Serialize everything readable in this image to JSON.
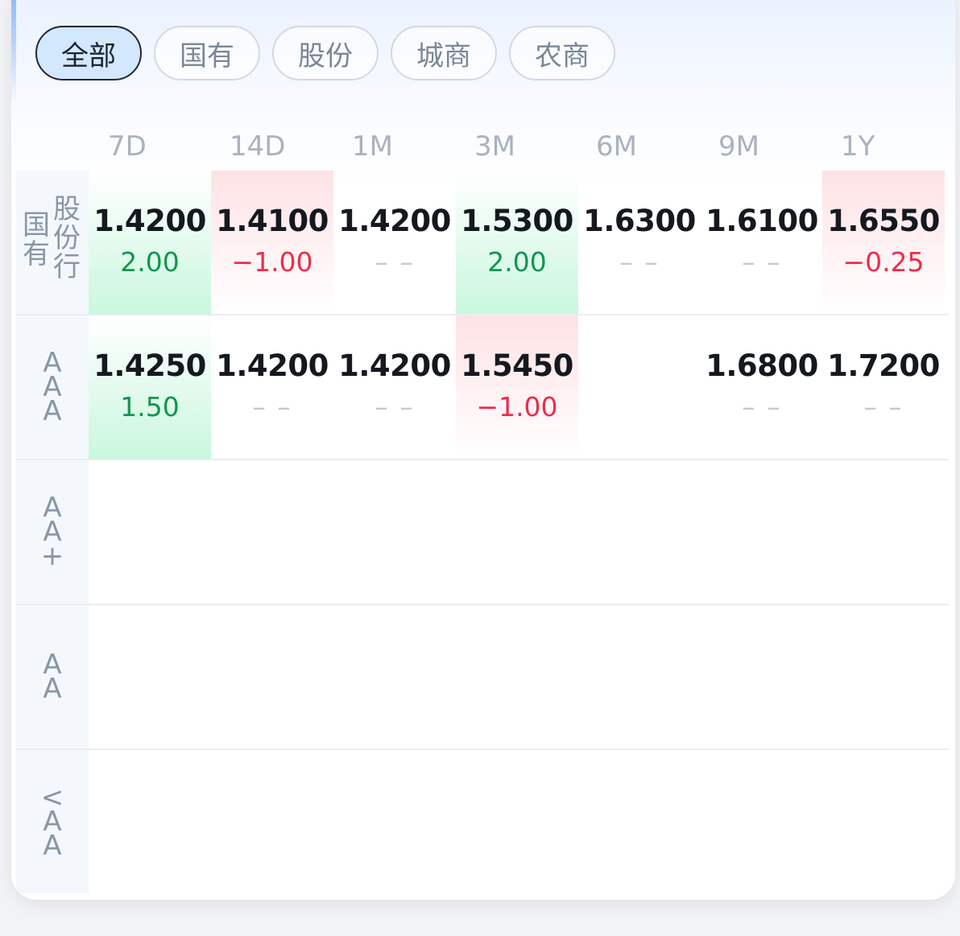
{
  "filters": {
    "items": [
      {
        "label": "全部",
        "active": true
      },
      {
        "label": "国有",
        "active": false
      },
      {
        "label": "股份",
        "active": false
      },
      {
        "label": "城商",
        "active": false
      },
      {
        "label": "农商",
        "active": false
      }
    ]
  },
  "tenors": [
    "7D",
    "14D",
    "1M",
    "3M",
    "6M",
    "9M",
    "1Y"
  ],
  "rows": [
    {
      "label_left": "国有",
      "label_right": "股份行",
      "cells": [
        {
          "rate": "1.4200",
          "change": "2.00",
          "trend": "up"
        },
        {
          "rate": "1.4100",
          "change": "−1.00",
          "trend": "down"
        },
        {
          "rate": "1.4200",
          "change": "– –",
          "trend": "none"
        },
        {
          "rate": "1.5300",
          "change": "2.00",
          "trend": "up"
        },
        {
          "rate": "1.6300",
          "change": "– –",
          "trend": "none"
        },
        {
          "rate": "1.6100",
          "change": "– –",
          "trend": "none"
        },
        {
          "rate": "1.6550",
          "change": "−0.25",
          "trend": "down"
        }
      ]
    },
    {
      "label": "AAA",
      "cells": [
        {
          "rate": "1.4250",
          "change": "1.50",
          "trend": "up"
        },
        {
          "rate": "1.4200",
          "change": "– –",
          "trend": "none"
        },
        {
          "rate": "1.4200",
          "change": "– –",
          "trend": "none"
        },
        {
          "rate": "1.5450",
          "change": "−1.00",
          "trend": "down"
        },
        {
          "rate": "",
          "change": "",
          "trend": "none"
        },
        {
          "rate": "1.6800",
          "change": "– –",
          "trend": "none"
        },
        {
          "rate": "1.7200",
          "change": "– –",
          "trend": "none"
        }
      ]
    },
    {
      "label": "AA+",
      "cells": []
    },
    {
      "label": "AA",
      "cells": []
    },
    {
      "label": "<AA",
      "cells": []
    }
  ],
  "colors": {
    "up": "#12964f",
    "down": "#ef2c4a",
    "chip_active_bg": "#d3e7fd"
  }
}
